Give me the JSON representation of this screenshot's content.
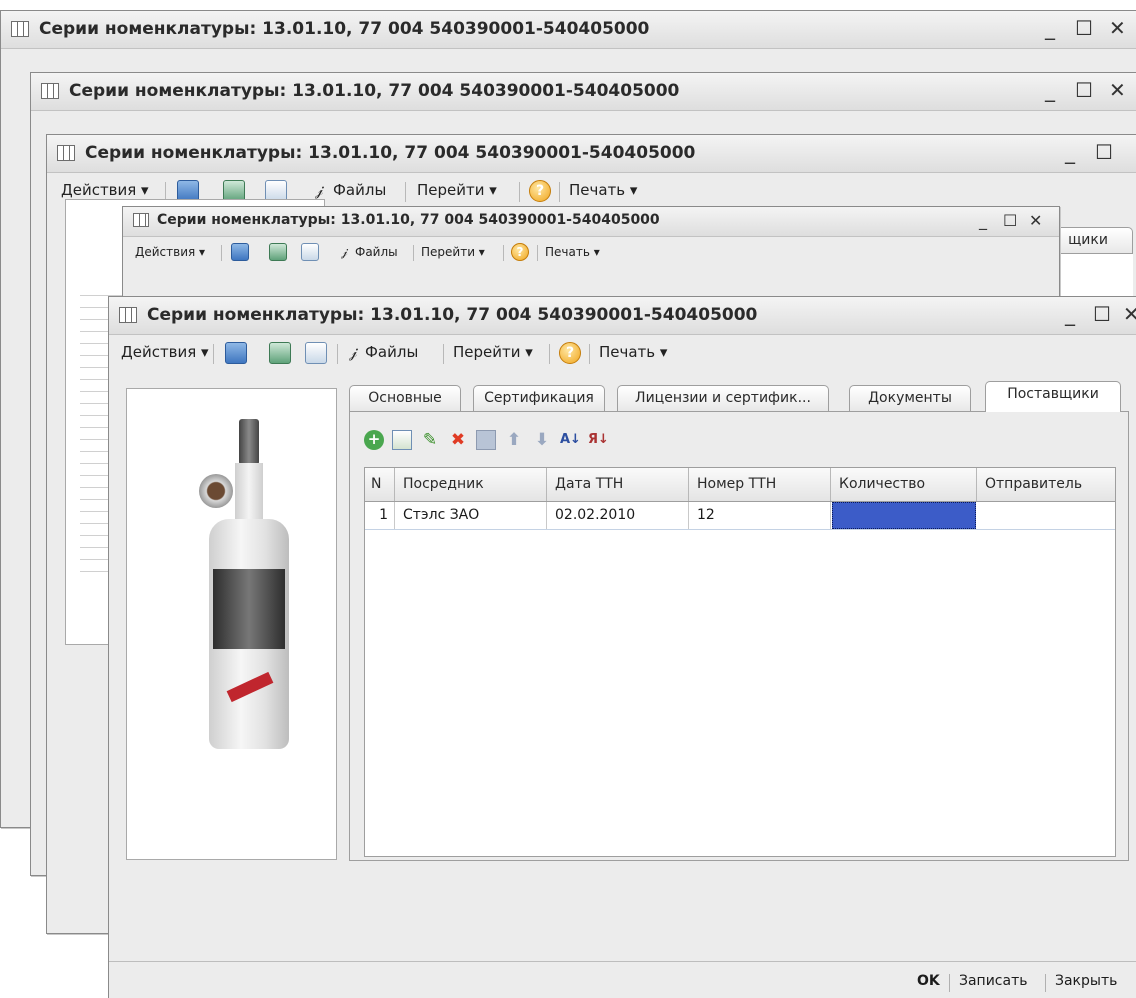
{
  "windows": {
    "back": [
      {
        "title": "Серии номенклатуры: 13.01.10, 77 004 540390001-540405000"
      },
      {
        "title": "Серии номенклатуры: 13.01.10, 77 004 540390001-540405000"
      },
      {
        "title": "Серии номенклатуры: 13.01.10, 77 004 540390001-540405000",
        "toolbar": {
          "actions": "Действия ▾",
          "files": "Файлы",
          "goto": "Перейти ▾",
          "print": "Печать ▾"
        },
        "tab_partial": "щики"
      },
      {
        "title": "Серии номенклатуры: 13.01.10, 77 004 540390001-540405000",
        "toolbar": {
          "actions": "Действия ▾",
          "files": "Файлы",
          "goto": "Перейти ▾",
          "print": "Печать ▾"
        }
      }
    ],
    "window_controls": {
      "minimize": "_",
      "maximize": "☐",
      "close": "✕"
    }
  },
  "main": {
    "title": "Серии номенклатуры: 13.01.10, 77 004 540390001-540405000",
    "toolbar": {
      "actions": "Действия ▾",
      "files": "Файлы",
      "goto": "Перейти ▾",
      "print": "Печать ▾"
    },
    "tabs": [
      {
        "label": "Основные"
      },
      {
        "label": "Сертификация"
      },
      {
        "label": "Лицензии и сертифик..."
      },
      {
        "label": "Документы"
      },
      {
        "label": "Поставщики",
        "active": true
      }
    ],
    "table": {
      "columns": [
        "N",
        "Посредник",
        "Дата ТТН",
        "Номер ТТН",
        "Количество",
        "Отправитель"
      ],
      "rows": [
        {
          "n": "1",
          "intermediary": "Стэлс ЗАО",
          "date": "02.02.2010",
          "number": "12",
          "quantity": "",
          "sender": ""
        }
      ]
    },
    "footer": {
      "ok": "OK",
      "save": "Записать",
      "close": "Закрыть"
    }
  },
  "colors": {
    "selection": "#3c5cc8",
    "chrome": "#ececec"
  },
  "icons": [
    "table-icon",
    "add-icon",
    "copy-icon",
    "edit-icon",
    "delete-icon",
    "up-icon",
    "down-icon",
    "sort-asc-icon",
    "sort-desc-icon",
    "help-icon",
    "attachment-icon"
  ]
}
